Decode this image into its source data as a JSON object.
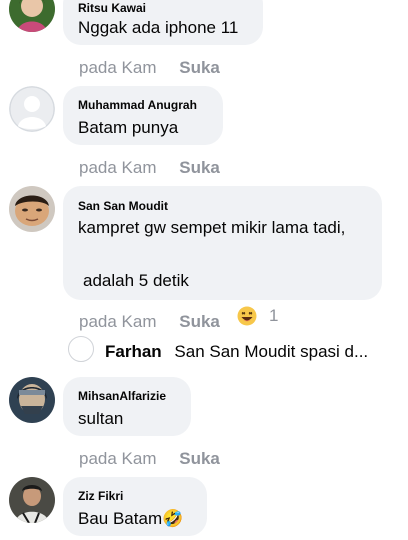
{
  "comments": [
    {
      "author": "Ritsu Kawai",
      "text": "Nggak ada iphone 11",
      "time": "pada Kam",
      "like_label": "Suka",
      "avatar_icon": "user-photo-avatar"
    },
    {
      "author": "Muhammad Anugrah",
      "text": "Batam punya",
      "time": "pada Kam",
      "like_label": "Suka",
      "avatar_icon": "default-silhouette-avatar"
    },
    {
      "author": "San San Moudit",
      "text_line1": "kampret gw sempet mikir lama tadi,",
      "text_line2": "adalah 5 detik",
      "time": "pada Kam",
      "like_label": "Suka",
      "reaction_icon": "laughing-emoji",
      "reaction_count": "1",
      "reply": {
        "name": "Farhan",
        "preview": "San San Moudit  spasi d..."
      }
    },
    {
      "author": "MihsanAlfarizie",
      "text": "sultan",
      "time": "pada Kam",
      "like_label": "Suka",
      "avatar_icon": "user-photo-avatar"
    },
    {
      "author": "Ziz Fikri",
      "text": "Bau Batam",
      "emoji": "🤣",
      "avatar_icon": "user-photo-avatar"
    }
  ],
  "colors": {
    "bubble": "#f0f2f5",
    "text": "#050505",
    "meta": "#90949c"
  }
}
